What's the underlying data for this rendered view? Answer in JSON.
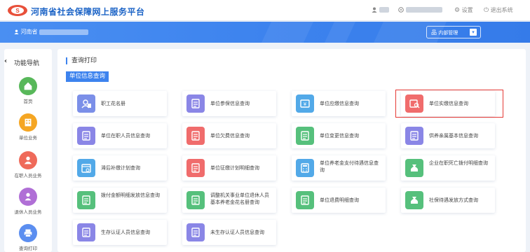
{
  "header": {
    "site_title": "河南省社会保障网上服务平台",
    "settings": "设置",
    "logout": "退出系统",
    "colors": {
      "brand_blue": "#3d83ee",
      "title_blue": "#1b63c6",
      "highlight_red": "#e53935"
    }
  },
  "userbar": {
    "region": "河南省",
    "internal_mgmt": "内部管理"
  },
  "sidebar": {
    "title": "功能导航",
    "items": [
      {
        "label": "首页",
        "icon": "home-icon",
        "color": "#58b85a"
      },
      {
        "label": "单位业务",
        "icon": "building-icon",
        "color": "#f5a623"
      },
      {
        "label": "在职人员业务",
        "icon": "worker-icon",
        "color": "#ef6a5a"
      },
      {
        "label": "退休人员业务",
        "icon": "retiree-icon",
        "color": "#b06fd6"
      },
      {
        "label": "查询打印",
        "icon": "printer-icon",
        "color": "#5b8ef0"
      }
    ]
  },
  "main": {
    "title": "查询打印",
    "section": "单位信息查询",
    "cards": [
      {
        "label": "职工花名册",
        "icon": "roster-icon",
        "color": "#7b8fe8"
      },
      {
        "label": "单位参保信息查询",
        "icon": "document-icon",
        "color": "#8a86e6"
      },
      {
        "label": "单位应缴信息查询",
        "icon": "payment-due-icon",
        "color": "#52a9e8"
      },
      {
        "label": "单位实缴信息查询",
        "icon": "payment-search-icon",
        "color": "#f06c6c"
      },
      {
        "label": "单位在职人员信息查询",
        "icon": "building-staff-icon",
        "color": "#8a86e6"
      },
      {
        "label": "单位欠费信息查询",
        "icon": "arrears-icon",
        "color": "#f06c6c"
      },
      {
        "label": "单位变更信息查询",
        "icon": "change-icon",
        "color": "#56c07c"
      },
      {
        "label": "供养亲属基本信息查询",
        "icon": "family-icon",
        "color": "#8a86e6"
      },
      {
        "label": "滞后补缴计划查询",
        "icon": "calendar-icon",
        "color": "#52a9e8"
      },
      {
        "label": "单位征缴计划明细查询",
        "icon": "plan-detail-icon",
        "color": "#f06c6c"
      },
      {
        "label": "单位养老金支付待遇信息查询",
        "icon": "calculator-icon",
        "color": "#52a9e8"
      },
      {
        "label": "企业在职死亡拨付明细查询",
        "icon": "bag-icon",
        "color": "#56c07c"
      },
      {
        "label": "拨付金额明细发放信息查询",
        "icon": "disbursement-icon",
        "color": "#56c07c"
      },
      {
        "label": "调整机关事业单位退休人员基本养老金花名册查询",
        "icon": "pension-adjust-icon",
        "color": "#56c07c"
      },
      {
        "label": "单位退费明细查询",
        "icon": "refund-icon",
        "color": "#56c07c"
      },
      {
        "label": "社保待遇发放方式查询",
        "icon": "money-bag-icon",
        "color": "#56c07c"
      },
      {
        "label": "生存认证人员信息查询",
        "icon": "certificate-icon",
        "color": "#8a86e6"
      },
      {
        "label": "未生存认证人员信息查询",
        "icon": "uncertified-icon",
        "color": "#8a86e6"
      }
    ]
  }
}
